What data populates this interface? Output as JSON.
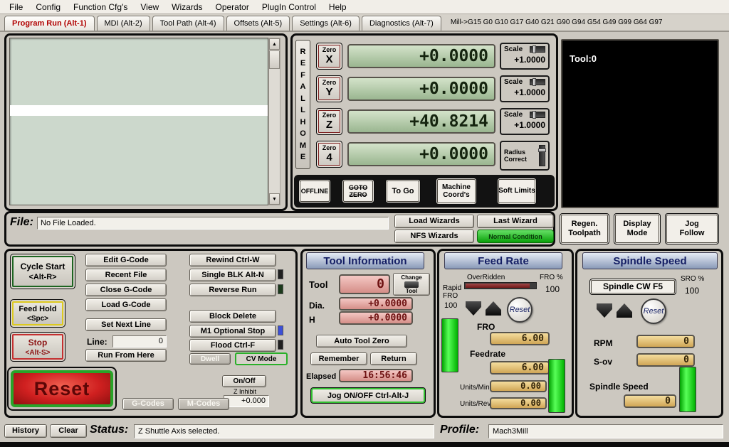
{
  "menu": {
    "items": [
      "File",
      "Config",
      "Function Cfg's",
      "View",
      "Wizards",
      "Operator",
      "PlugIn Control",
      "Help"
    ]
  },
  "tabs": {
    "items": [
      {
        "label": "Program Run (Alt-1)",
        "active": true
      },
      {
        "label": "MDI (Alt-2)",
        "active": false
      },
      {
        "label": "Tool Path (Alt-4)",
        "active": false
      },
      {
        "label": "Offsets (Alt-5)",
        "active": false
      },
      {
        "label": "Settings (Alt-6)",
        "active": false
      },
      {
        "label": "Diagnostics (Alt-7)",
        "active": false
      }
    ],
    "mill_codes": "Mill->G15  G0 G10 G17 G40 G21 G90 G94 G54 G49 G99 G64 G97"
  },
  "axis": {
    "ref_all_home": "REF ALL HOME",
    "zero_label": "Zero",
    "rows": [
      {
        "letter": "X",
        "value": "+0.0000"
      },
      {
        "letter": "Y",
        "value": "+0.0000"
      },
      {
        "letter": "Z",
        "value": "+40.8214"
      },
      {
        "letter": "4",
        "value": "+0.0000"
      }
    ],
    "scale_label": "Scale",
    "scales": [
      "+1.0000",
      "+1.0000",
      "+1.0000"
    ],
    "radius_correct_label": "Radius Correct",
    "offline": "OFFLINE",
    "goto_zero": "GOTO ZERO",
    "to_go": "To Go",
    "machine_coords": "Machine Coord's",
    "soft_limits": "Soft Limits"
  },
  "toolpath": {
    "label": "Tool:0"
  },
  "file_bar": {
    "label": "File:",
    "value": "No File Loaded.",
    "load_wizards": "Load Wizards",
    "last_wizard": "Last Wizard",
    "nfs_wizards": "NFS Wizards",
    "condition": "Normal Condition",
    "regen_toolpath": "Regen. Toolpath",
    "display_mode": "Display Mode",
    "jog_follow": "Jog Follow"
  },
  "controls": {
    "cycle_start": {
      "line1": "Cycle Start",
      "line2": "<Alt-R>"
    },
    "feed_hold": {
      "line1": "Feed Hold",
      "line2": "<Spc>"
    },
    "stop": {
      "line1": "Stop",
      "line2": "<Alt-S>"
    },
    "reset_label": "Reset",
    "edit_gcode": "Edit G-Code",
    "recent_file": "Recent File",
    "close_gcode": "Close G-Code",
    "load_gcode": "Load G-Code",
    "set_next_line": "Set Next Line",
    "line_label": "Line:",
    "line_value": "0",
    "run_from_here": "Run From Here",
    "rewind": "Rewind Ctrl-W",
    "single_blk": "Single BLK Alt-N",
    "reverse_run": "Reverse Run",
    "block_delete": "Block Delete",
    "m1_optional_stop": "M1 Optional Stop",
    "flood": "Flood Ctrl-F",
    "dwell": "Dwell",
    "cv_mode": "CV Mode",
    "on_off": "On/Off",
    "z_inhibit_label": "Z Inhibit",
    "z_inhibit_value": "+0.000",
    "g_codes": "G-Codes",
    "m_codes": "M-Codes"
  },
  "tool_info": {
    "title": "Tool Information",
    "tool_label": "Tool",
    "tool_value": "0",
    "change_tool_top": "Change",
    "change_tool_bottom": "Tool",
    "dia_label": "Dia.",
    "dia_value": "+0.0000",
    "h_label": "H",
    "h_value": "+0.0000",
    "auto_tool_zero": "Auto Tool Zero",
    "remember": "Remember",
    "return": "Return",
    "elapsed_label": "Elapsed",
    "elapsed_value": "16:56:46",
    "jog_toggle": "Jog ON/OFF Ctrl-Alt-J"
  },
  "feed_rate": {
    "title": "Feed Rate",
    "overridden_label": "OverRidden",
    "fro_percent_label": "FRO %",
    "fro_percent_value": "100",
    "rapid_label": "Rapid",
    "rapid_fro_label": "FRO",
    "rapid_fro_value": "100",
    "reset_label": "Reset",
    "fro_label": "FRO",
    "fro_value": "6.00",
    "feedrate_label": "Feedrate",
    "feedrate_value": "6.00",
    "units_min_label": "Units/Min",
    "units_min_value": "0.00",
    "units_rev_label": "Units/Rev",
    "units_rev_value": "0.00"
  },
  "spindle": {
    "title": "Spindle Speed",
    "toggle_label": "Spindle CW F5",
    "sro_percent_label": "SRO %",
    "sro_percent_value": "100",
    "reset_label": "Reset",
    "rpm_label": "RPM",
    "rpm_value": "0",
    "sov_label": "S-ov",
    "sov_value": "0",
    "speed_label": "Spindle Speed",
    "speed_value": "0"
  },
  "status_bar": {
    "history": "History",
    "clear": "Clear",
    "status_label": "Status:",
    "status_message": "Z Shuttle Axis selected.",
    "profile_label": "Profile:",
    "profile_value": "Mach3Mill"
  },
  "icons": {
    "scroll_up": "▲",
    "scroll_down": "▼"
  },
  "colors": {
    "active_tab_text": "#b00000",
    "dro_green_bg": "#b8cfae",
    "value_pink_bg": "#e4aca6",
    "value_gold_bg": "#e2c078",
    "indicator_green": "#22dd22",
    "panel_title_text": "#141e64",
    "override_bar_maroon": "#7c2020",
    "reset_button_red": "#c81e1e",
    "m1_led_blue": "#3c50d8"
  }
}
